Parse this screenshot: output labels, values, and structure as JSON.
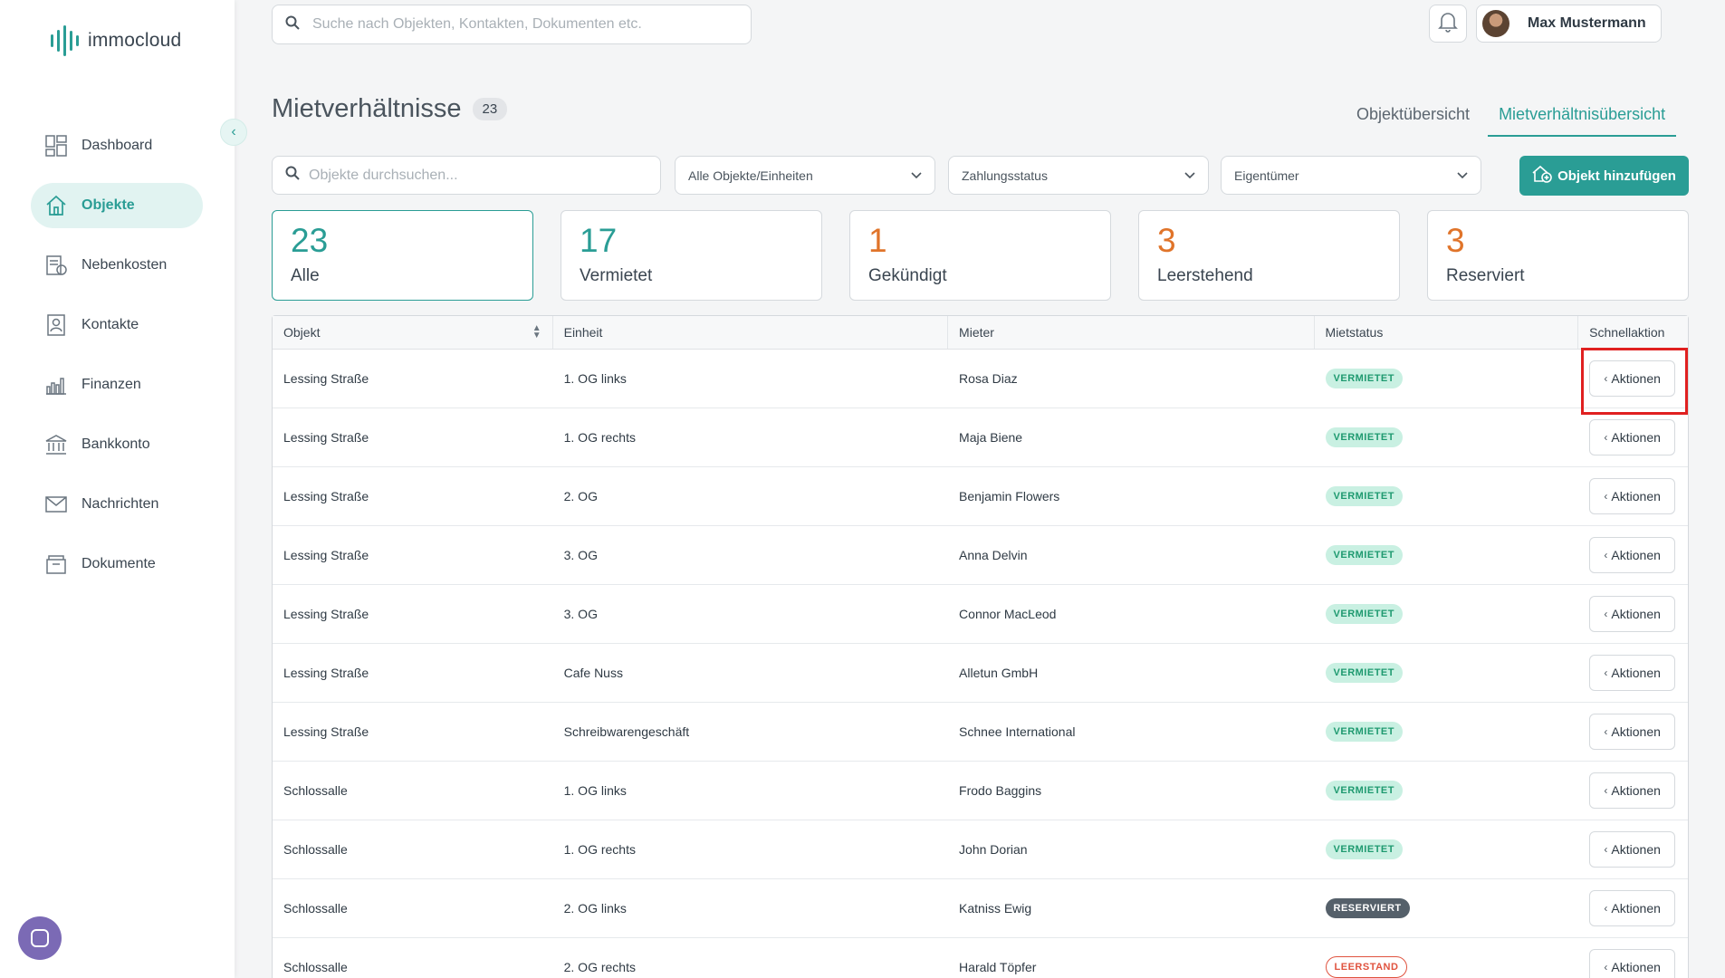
{
  "app": {
    "name": "immocloud"
  },
  "sidebar": {
    "items": [
      {
        "label": "Dashboard",
        "icon": "dashboard-icon"
      },
      {
        "label": "Objekte",
        "icon": "home-icon",
        "active": true
      },
      {
        "label": "Nebenkosten",
        "icon": "receipt-icon"
      },
      {
        "label": "Kontakte",
        "icon": "contacts-icon"
      },
      {
        "label": "Finanzen",
        "icon": "bar-chart-icon"
      },
      {
        "label": "Bankkonto",
        "icon": "bank-icon"
      },
      {
        "label": "Nachrichten",
        "icon": "mail-icon"
      },
      {
        "label": "Dokumente",
        "icon": "folder-icon"
      }
    ]
  },
  "header": {
    "search_placeholder": "Suche nach Objekten, Kontakten, Dokumenten etc.",
    "user_name": "Max Mustermann"
  },
  "page": {
    "title": "Mietverhältnisse",
    "count": "23",
    "tabs": [
      "Objektübersicht",
      "Mietverhältnisübersicht"
    ]
  },
  "filters": {
    "search_placeholder": "Objekte durchsuchen...",
    "objects_select": "Alle Objekte/Einheiten",
    "payment_select": "Zahlungsstatus",
    "owner_select": "Eigentümer",
    "add_button": "Objekt hinzufügen"
  },
  "stats": [
    {
      "value": "23",
      "label": "Alle",
      "color": "#2a9d95"
    },
    {
      "value": "17",
      "label": "Vermietet",
      "color": "#2a9d95"
    },
    {
      "value": "1",
      "label": "Gekündigt",
      "color": "#e0742a"
    },
    {
      "value": "3",
      "label": "Leerstehend",
      "color": "#e0742a"
    },
    {
      "value": "3",
      "label": "Reserviert",
      "color": "#e0742a"
    }
  ],
  "table": {
    "columns": [
      "Objekt",
      "Einheit",
      "Mieter",
      "Mietstatus",
      "Schnellaktion"
    ],
    "action_label": "Aktionen",
    "rows": [
      {
        "objekt": "Lessing Straße",
        "einheit": "1. OG links",
        "mieter": "Rosa Diaz",
        "status": "VERMIETET"
      },
      {
        "objekt": "Lessing Straße",
        "einheit": "1. OG rechts",
        "mieter": "Maja Biene",
        "status": "VERMIETET"
      },
      {
        "objekt": "Lessing Straße",
        "einheit": "2. OG",
        "mieter": "Benjamin Flowers",
        "status": "VERMIETET"
      },
      {
        "objekt": "Lessing Straße",
        "einheit": "3. OG",
        "mieter": "Anna Delvin",
        "status": "VERMIETET"
      },
      {
        "objekt": "Lessing Straße",
        "einheit": "3. OG",
        "mieter": "Connor MacLeod",
        "status": "VERMIETET"
      },
      {
        "objekt": "Lessing Straße",
        "einheit": "Cafe Nuss",
        "mieter": "Alletun GmbH",
        "status": "VERMIETET"
      },
      {
        "objekt": "Lessing Straße",
        "einheit": "Schreibwarengeschäft",
        "mieter": "Schnee International",
        "status": "VERMIETET"
      },
      {
        "objekt": "Schlossalle",
        "einheit": "1. OG links",
        "mieter": "Frodo Baggins",
        "status": "VERMIETET"
      },
      {
        "objekt": "Schlossalle",
        "einheit": "1. OG rechts",
        "mieter": "John Dorian",
        "status": "VERMIETET"
      },
      {
        "objekt": "Schlossalle",
        "einheit": "2. OG links",
        "mieter": "Katniss Ewig",
        "status": "RESERVIERT"
      },
      {
        "objekt": "Schlossalle",
        "einheit": "2. OG rechts",
        "mieter": "Harald Töpfer",
        "status": "LEERSTAND"
      }
    ]
  },
  "colors": {
    "accent": "#2a9d95",
    "warning": "#e0742a",
    "highlight": "#e02020"
  }
}
